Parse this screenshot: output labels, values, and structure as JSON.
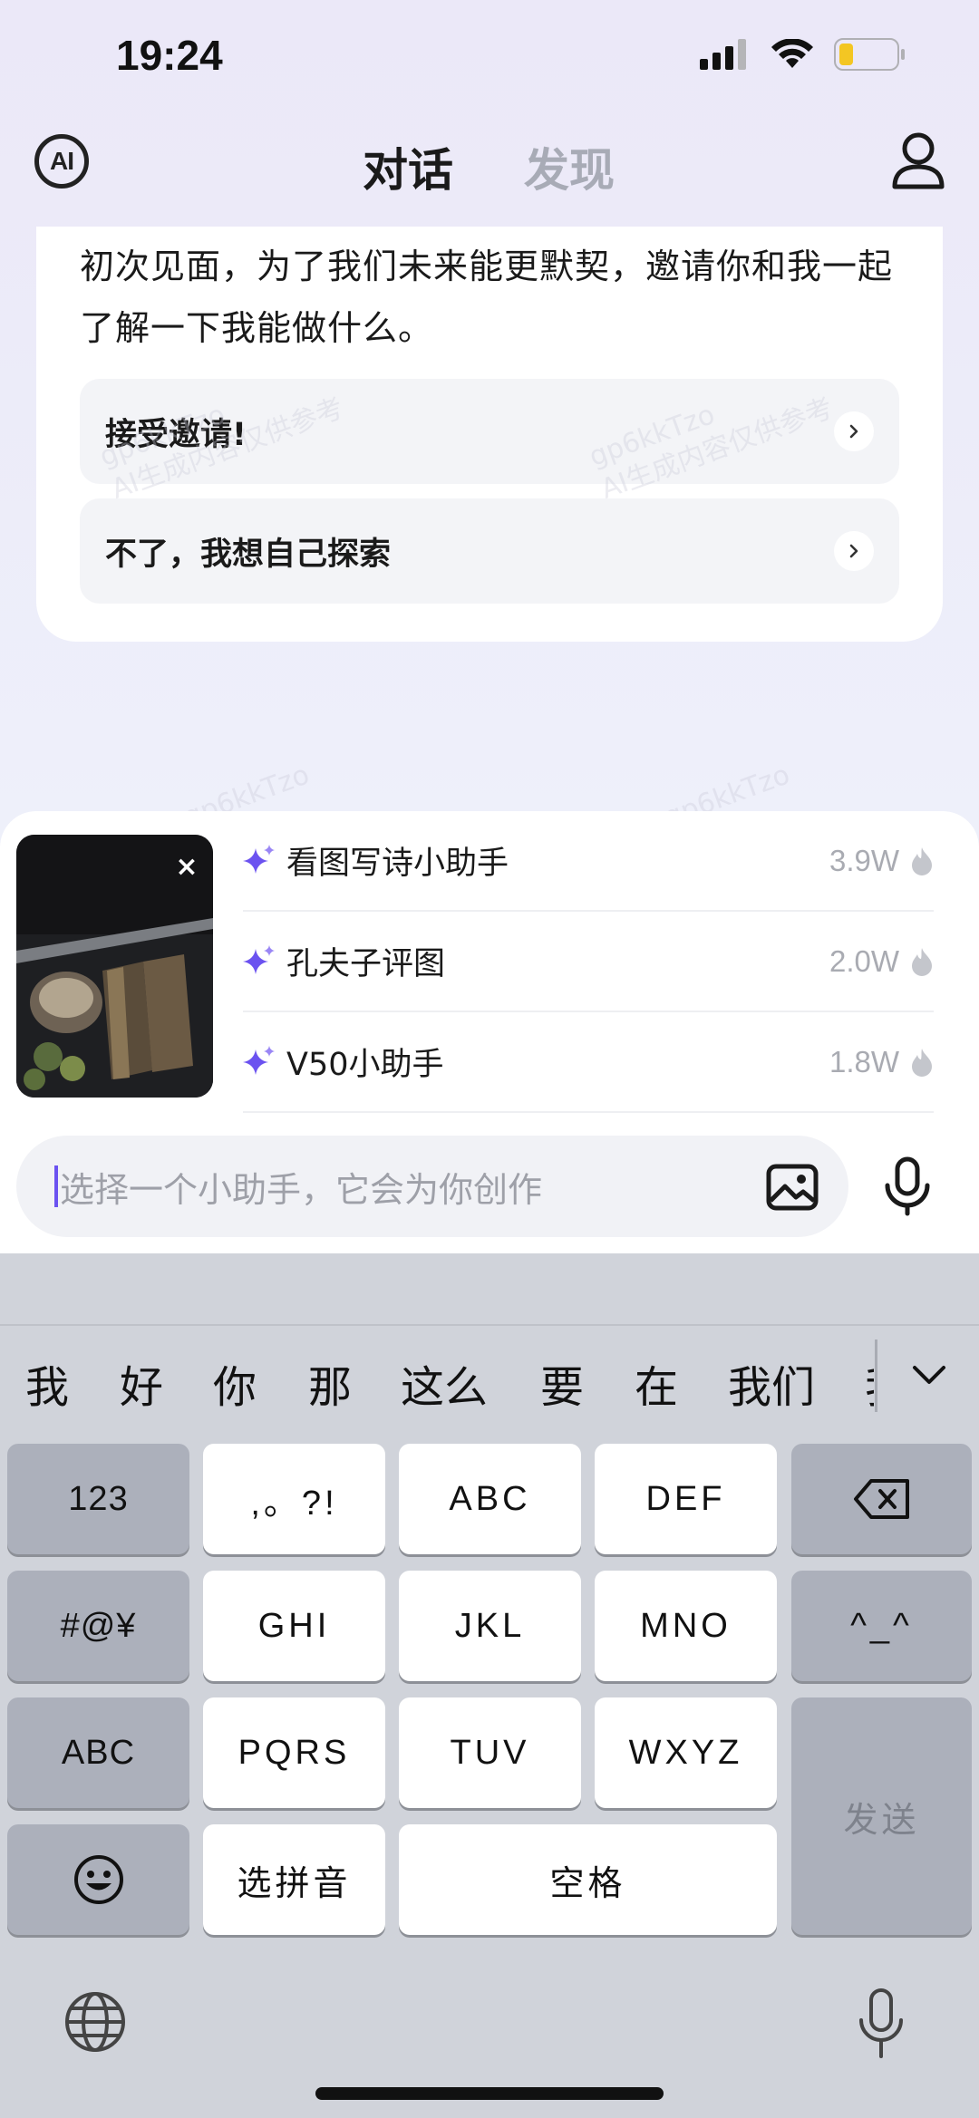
{
  "status": {
    "time": "19:24"
  },
  "header": {
    "logo_text": "AI",
    "tab_chat": "对话",
    "tab_discover": "发现"
  },
  "card": {
    "intro_text": "初次见面，为了我们未来能更默契，邀请你和我一起了解一下我能做什么。",
    "options": [
      {
        "label": "接受邀请!"
      },
      {
        "label": "不了，我想自己探索"
      }
    ]
  },
  "watermark": {
    "line1": "gp6kkTzo",
    "line2": "AI生成内容仅供参考"
  },
  "assistants": [
    {
      "name": "看图写诗小助手",
      "count": "3.9W"
    },
    {
      "name": "孔夫子评图",
      "count": "2.0W"
    },
    {
      "name": "V50小助手",
      "count": "1.8W"
    }
  ],
  "thumbnail": {
    "close": "×"
  },
  "input": {
    "placeholder": "选择一个小助手，它会为你创作"
  },
  "keyboard": {
    "candidates": [
      "我",
      "好",
      "你",
      "那",
      "这么",
      "要",
      "在",
      "我们",
      "我"
    ],
    "rows": {
      "r1": [
        "123",
        ",。?!",
        "ABC",
        "DEF"
      ],
      "r2": [
        "#@¥",
        "GHI",
        "JKL",
        "MNO",
        "^_^"
      ],
      "r3": [
        "ABC",
        "PQRS",
        "TUV",
        "WXYZ"
      ],
      "r4": [
        "选拼音",
        "空格"
      ],
      "send": "发送"
    }
  },
  "icons": {
    "logo": "ai-logo-icon",
    "profile": "user-icon",
    "chevron": "chevron-right-icon",
    "sparkle": "sparkle-icon",
    "flame": "flame-icon",
    "image": "image-icon",
    "mic": "microphone-icon",
    "backspace": "backspace-icon",
    "emoji": "emoji-icon",
    "globe": "globe-icon",
    "collapse": "chevron-down-icon"
  },
  "colors": {
    "accent": "#6b52f0",
    "muted": "#a8abb6",
    "keyboard_bg": "#d0d3da"
  }
}
